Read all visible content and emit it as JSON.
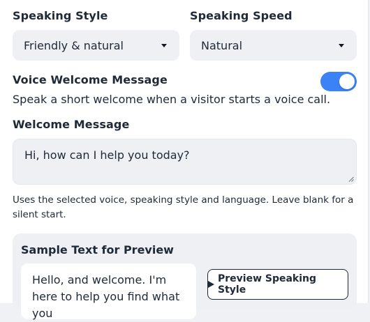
{
  "speaking_style": {
    "label": "Speaking Style",
    "selected": "Friendly & natural"
  },
  "speaking_speed": {
    "label": "Speaking Speed",
    "selected": "Natural"
  },
  "voice_welcome": {
    "label": "Voice Welcome Message",
    "enabled": true,
    "description": "Speak a short welcome when a visitor starts a voice call."
  },
  "welcome_message": {
    "label": "Welcome Message",
    "value": "Hi, how can I help you today?",
    "hint": "Uses the selected voice, speaking style and language. Leave blank for a silent start."
  },
  "preview": {
    "title": "Sample Text for Preview",
    "sample_text": "Hello, and welcome. I'm here to help you find what you",
    "button_label": "Preview Speaking Style",
    "play_icon": "play-icon"
  },
  "colors": {
    "accent": "#3b82f6",
    "field_bg": "#eef0f3"
  }
}
